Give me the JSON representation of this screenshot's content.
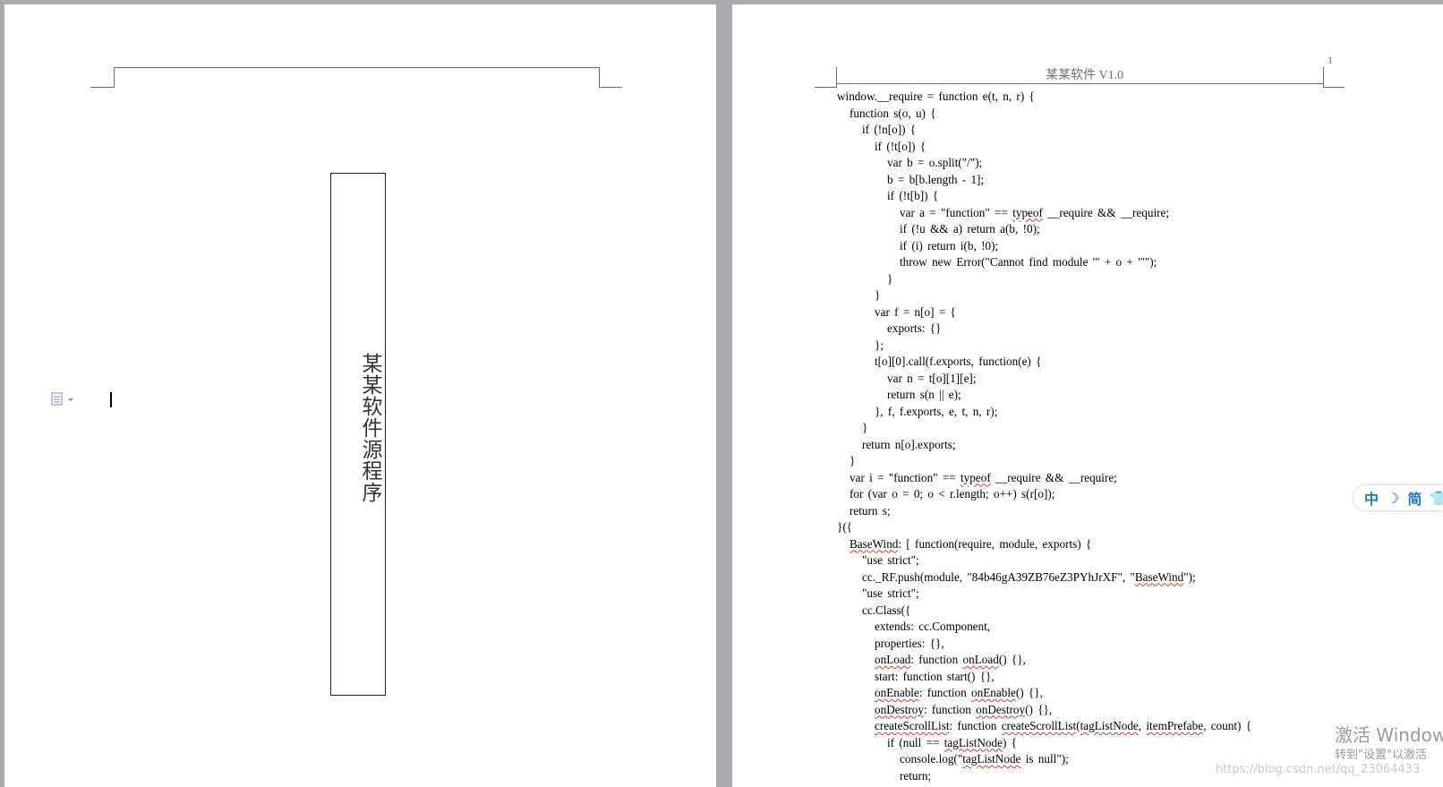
{
  "left_page": {
    "title_vertical": "某某软件源程序"
  },
  "right_page": {
    "header_text": "某某软件 V1.0",
    "page_number": "1",
    "code_lines": [
      {
        "indent": 0,
        "text": "window.__require = function e(t, n, r) {"
      },
      {
        "indent": 1,
        "text": "function s(o, u) {"
      },
      {
        "indent": 2,
        "text": "if (!n[o]) {"
      },
      {
        "indent": 3,
        "text": "if (!t[o]) {"
      },
      {
        "indent": 4,
        "text": "var b = o.split(\"/\");"
      },
      {
        "indent": 4,
        "text": "b = b[b.length - 1];"
      },
      {
        "indent": 4,
        "text": "if (!t[b]) {"
      },
      {
        "indent": 5,
        "text": "var a = \"function\" == typeof __require && __require;"
      },
      {
        "indent": 5,
        "text": "if (!u && a) return a(b, !0);"
      },
      {
        "indent": 5,
        "text": "if (i) return i(b, !0);"
      },
      {
        "indent": 5,
        "text": "throw new Error(\"Cannot find module '\" + o + \"'\");"
      },
      {
        "indent": 4,
        "text": "}"
      },
      {
        "indent": 3,
        "text": "}"
      },
      {
        "indent": 3,
        "text": "var f = n[o] = {"
      },
      {
        "indent": 4,
        "text": "exports: {}"
      },
      {
        "indent": 3,
        "text": "};"
      },
      {
        "indent": 3,
        "text": "t[o][0].call(f.exports, function(e) {"
      },
      {
        "indent": 4,
        "text": "var n = t[o][1][e];"
      },
      {
        "indent": 4,
        "text": "return s(n || e);"
      },
      {
        "indent": 3,
        "text": "}, f, f.exports, e, t, n, r);"
      },
      {
        "indent": 2,
        "text": "}"
      },
      {
        "indent": 2,
        "text": "return n[o].exports;"
      },
      {
        "indent": 1,
        "text": "}"
      },
      {
        "indent": 1,
        "text": "var i = \"function\" == typeof __require && __require;"
      },
      {
        "indent": 1,
        "text": "for (var o = 0; o < r.length; o++) s(r[o]);"
      },
      {
        "indent": 1,
        "text": "return s;"
      },
      {
        "indent": 0,
        "text": "}({"
      },
      {
        "indent": 1,
        "text": "BaseWind: [ function(require, module, exports) {"
      },
      {
        "indent": 2,
        "text": "\"use strict\";"
      },
      {
        "indent": 2,
        "text": "cc._RF.push(module, \"84b46gA39ZB76eZ3PYhJrXF\", \"BaseWind\");"
      },
      {
        "indent": 2,
        "text": "\"use strict\";"
      },
      {
        "indent": 2,
        "text": "cc.Class({"
      },
      {
        "indent": 3,
        "text": "extends: cc.Component,"
      },
      {
        "indent": 3,
        "text": "properties: {},"
      },
      {
        "indent": 3,
        "text": "onLoad: function onLoad() {},"
      },
      {
        "indent": 3,
        "text": "start: function start() {},"
      },
      {
        "indent": 3,
        "text": "onEnable: function onEnable() {},"
      },
      {
        "indent": 3,
        "text": "onDestroy: function onDestroy() {},"
      },
      {
        "indent": 3,
        "text": "createScrollList: function createScrollList(tagListNode, itemPrefabe, count) {"
      },
      {
        "indent": 4,
        "text": "if (null == tagListNode) {"
      },
      {
        "indent": 5,
        "text": "console.log(\"tagListNode is null\");"
      },
      {
        "indent": 5,
        "text": "return;"
      }
    ],
    "spellcheck_words": [
      "typeof",
      "BaseWind",
      "onLoad",
      "onEnable",
      "onDestroy",
      "createScrollList",
      "tagListNode",
      "itemPrefabe"
    ]
  },
  "ime_bar": {
    "lang": "中",
    "moon": "☽",
    "mode": "简",
    "shirt": "👕"
  },
  "watermark": {
    "title": "激活 Windows",
    "subtitle": "转到\"设置\"以激活",
    "csdn": "https://blog.csdn.net/qq_23064433"
  },
  "colors": {
    "desk": "#a9abae",
    "page": "#ffffff",
    "ime_blue": "#1e7ad6",
    "spellcheck": "#d23a3a"
  }
}
